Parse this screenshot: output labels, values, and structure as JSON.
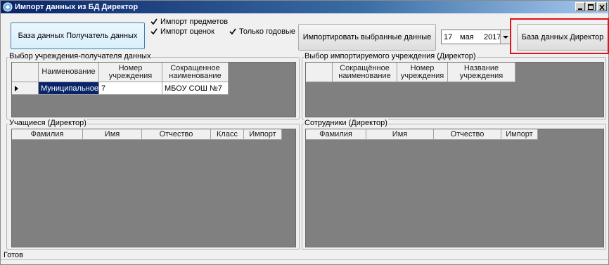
{
  "window": {
    "title": "Импорт данных из БД Директор"
  },
  "toolbar": {
    "recipient_db_button": "База данных Получатель данных",
    "import_subjects_label": "Импорт предметов",
    "import_grades_label": "Импорт оценок",
    "only_yearly_label": "Только годовые",
    "import_selected_button": "Импортировать выбранные данные",
    "date": {
      "day": "17",
      "month": "мая",
      "year": "2017"
    },
    "director_db_button": "База данных Директор"
  },
  "recipient_org": {
    "legend": "Выбор учреждения-получателя данных",
    "columns": [
      "Наименование",
      "Номер учреждения",
      "Сокращенное наименование"
    ],
    "rows": [
      {
        "name": "Муниципальное ...",
        "number": "7",
        "short_name": "МБОУ СОШ №7"
      }
    ]
  },
  "import_org": {
    "legend": "Выбор импортируемого учреждения (Директор)",
    "columns": [
      "Сокращённое наименование",
      "Номер учреждения",
      "Название учреждения"
    ]
  },
  "students": {
    "legend": "Учащиеся (Директор)",
    "columns": [
      "Фамилия",
      "Имя",
      "Отчество",
      "Класс",
      "Импорт"
    ]
  },
  "staff": {
    "legend": "Сотрудники (Директор)",
    "columns": [
      "Фамилия",
      "Имя",
      "Отчество",
      "Импорт"
    ]
  },
  "status": {
    "text": "Готов"
  }
}
